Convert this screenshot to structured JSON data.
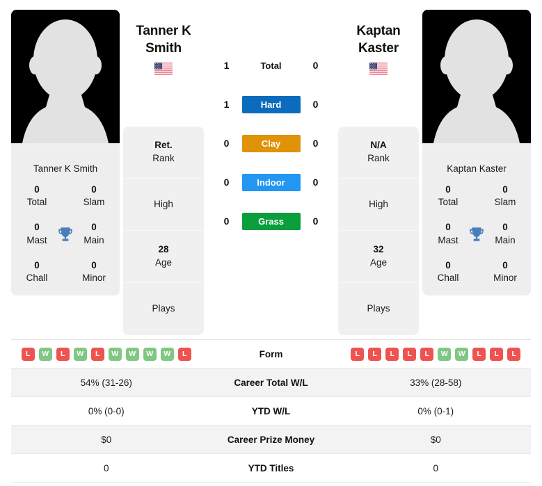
{
  "players": {
    "left": {
      "name_display": "Tanner K\nSmith",
      "name_line1": "Tanner K",
      "name_line2": "Smith",
      "name_full": "Tanner K Smith",
      "flag": "us-flag-icon",
      "titles": [
        {
          "value": "0",
          "label": "Total"
        },
        {
          "value": "0",
          "label": "Slam"
        },
        {
          "value": "0",
          "label": "Mast"
        },
        {
          "value": "0",
          "label": "Main"
        },
        {
          "value": "0",
          "label": "Chall"
        },
        {
          "value": "0",
          "label": "Minor"
        }
      ],
      "info": [
        {
          "value": "Ret.",
          "label": "Rank"
        },
        {
          "value": "",
          "label": "High"
        },
        {
          "value": "28",
          "label": "Age"
        },
        {
          "value": "",
          "label": "Plays"
        }
      ],
      "form": [
        "L",
        "W",
        "L",
        "W",
        "L",
        "W",
        "W",
        "W",
        "W",
        "L"
      ],
      "stats": {
        "career_total_wl": "54% (31-26)",
        "ytd_wl": "0% (0-0)",
        "career_prize_money": "$0",
        "ytd_titles": "0"
      }
    },
    "right": {
      "name_display": "Kaptan\nKaster",
      "name_line1": "Kaptan",
      "name_line2": "Kaster",
      "name_full": "Kaptan Kaster",
      "flag": "us-flag-icon",
      "titles": [
        {
          "value": "0",
          "label": "Total"
        },
        {
          "value": "0",
          "label": "Slam"
        },
        {
          "value": "0",
          "label": "Mast"
        },
        {
          "value": "0",
          "label": "Main"
        },
        {
          "value": "0",
          "label": "Chall"
        },
        {
          "value": "0",
          "label": "Minor"
        }
      ],
      "info": [
        {
          "value": "N/A",
          "label": "Rank"
        },
        {
          "value": "",
          "label": "High"
        },
        {
          "value": "32",
          "label": "Age"
        },
        {
          "value": "",
          "label": "Plays"
        }
      ],
      "form": [
        "L",
        "L",
        "L",
        "L",
        "L",
        "W",
        "W",
        "L",
        "L",
        "L"
      ],
      "stats": {
        "career_total_wl": "33% (28-58)",
        "ytd_wl": "0% (0-1)",
        "career_prize_money": "$0",
        "ytd_titles": "0"
      }
    }
  },
  "surfaces": [
    {
      "label": "Total",
      "left": "1",
      "right": "0",
      "color": "transparent",
      "plain": true
    },
    {
      "label": "Hard",
      "left": "1",
      "right": "0",
      "color": "#0b6cbd",
      "plain": false
    },
    {
      "label": "Clay",
      "left": "0",
      "right": "0",
      "color": "#e09208",
      "plain": false
    },
    {
      "label": "Indoor",
      "left": "0",
      "right": "0",
      "color": "#2196f3",
      "plain": false
    },
    {
      "label": "Grass",
      "left": "0",
      "right": "0",
      "color": "#0a9e3c",
      "plain": false
    }
  ],
  "stats_rows": [
    {
      "label": "Form",
      "type": "form",
      "shaded": false
    },
    {
      "label": "Career Total W/L",
      "type": "text",
      "shaded": true,
      "key": "career_total_wl"
    },
    {
      "label": "YTD W/L",
      "type": "text",
      "shaded": false,
      "key": "ytd_wl"
    },
    {
      "label": "Career Prize Money",
      "type": "text",
      "shaded": true,
      "key": "career_prize_money"
    },
    {
      "label": "YTD Titles",
      "type": "text",
      "shaded": false,
      "key": "ytd_titles"
    }
  ],
  "colors": {
    "form_win": "#ef5350",
    "form_loss": "#81c784",
    "win_badge": "#81c784",
    "loss_badge": "#ef5350",
    "card_bg": "#eeeeee",
    "info_bg": "#f0f0f0",
    "trophy": "#4a7ebb",
    "row_shade": "#f3f3f3"
  }
}
